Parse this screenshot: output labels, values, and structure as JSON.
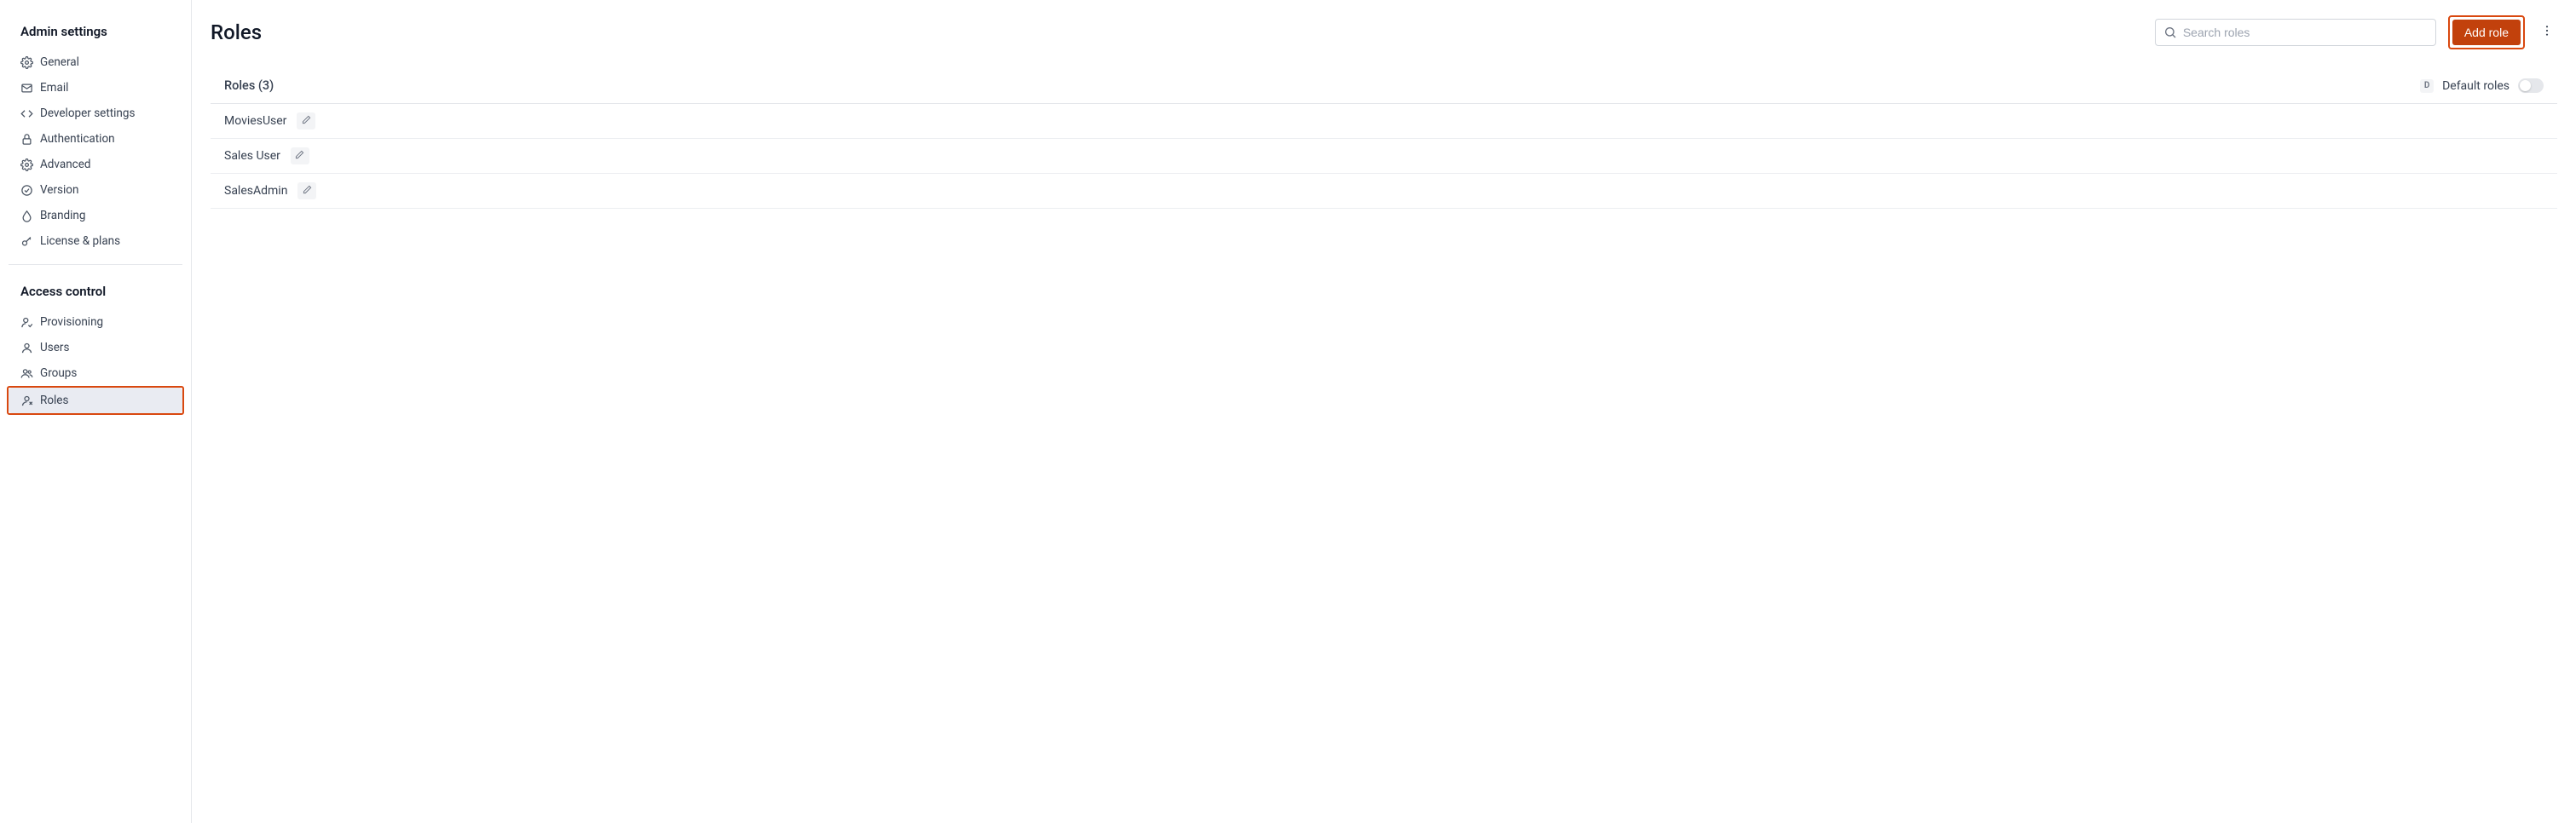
{
  "sidebar": {
    "section1_title": "Admin settings",
    "section2_title": "Access control",
    "items1": [
      {
        "label": "General"
      },
      {
        "label": "Email"
      },
      {
        "label": "Developer settings"
      },
      {
        "label": "Authentication"
      },
      {
        "label": "Advanced"
      },
      {
        "label": "Version"
      },
      {
        "label": "Branding"
      },
      {
        "label": "License & plans"
      }
    ],
    "items2": [
      {
        "label": "Provisioning"
      },
      {
        "label": "Users"
      },
      {
        "label": "Groups"
      },
      {
        "label": "Roles"
      }
    ]
  },
  "page": {
    "title": "Roles",
    "search_placeholder": "Search roles",
    "add_role_label": "Add role"
  },
  "section": {
    "title": "Roles (3)",
    "default_badge": "D",
    "default_label": "Default roles"
  },
  "roles": [
    {
      "name": "MoviesUser"
    },
    {
      "name": "Sales User"
    },
    {
      "name": "SalesAdmin"
    }
  ]
}
